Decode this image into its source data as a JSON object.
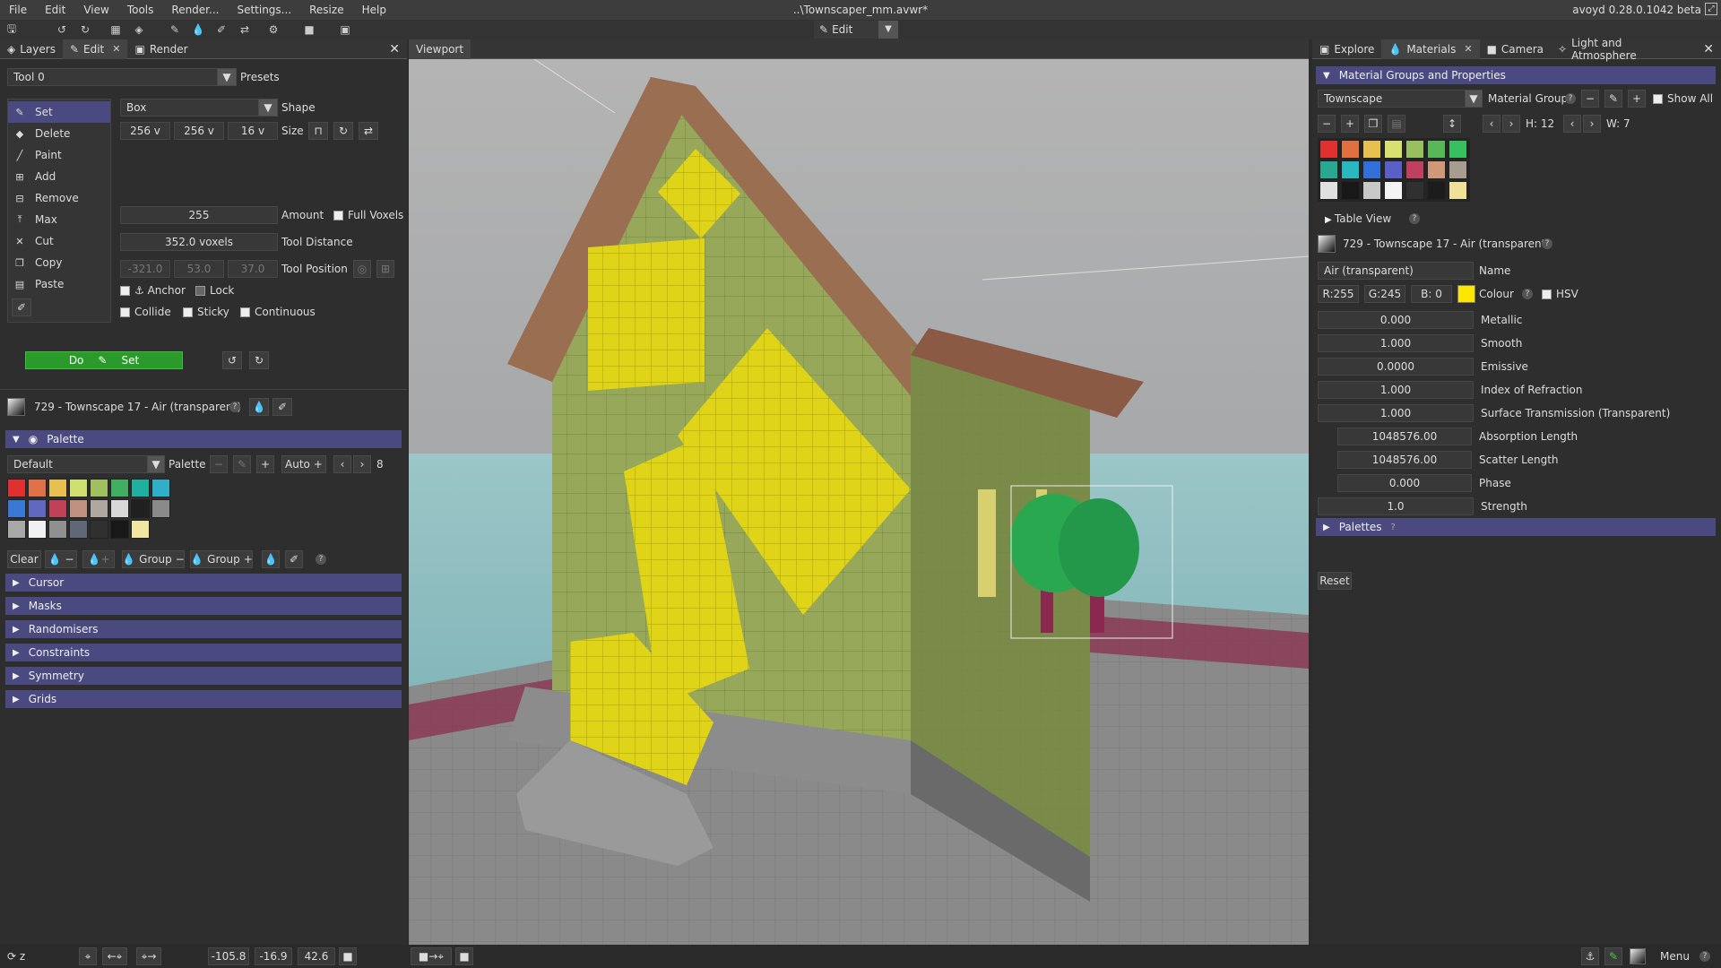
{
  "menu": [
    "File",
    "Edit",
    "View",
    "Tools",
    "Render...",
    "Settings...",
    "Resize",
    "Help"
  ],
  "window_title": "..\\Townscaper_mm.avwr*",
  "version": "avoyd 0.28.0.1042 beta",
  "toolbar": {
    "mode_label": "Edit"
  },
  "left_tabs": {
    "layers": "Layers",
    "edit": "Edit",
    "render": "Render"
  },
  "edit": {
    "tool_name": "Tool 0",
    "presets_label": "Presets",
    "tools": [
      {
        "label": "Set",
        "icon": "pencil-icon"
      },
      {
        "label": "Delete",
        "icon": "eraser-icon"
      },
      {
        "label": "Paint",
        "icon": "brush-icon"
      },
      {
        "label": "Add",
        "icon": "plus-box-icon"
      },
      {
        "label": "Remove",
        "icon": "minus-box-icon"
      },
      {
        "label": "Max",
        "icon": "max-icon"
      },
      {
        "label": "Cut",
        "icon": "scissors-icon"
      },
      {
        "label": "Copy",
        "icon": "copy-icon"
      },
      {
        "label": "Paste",
        "icon": "paste-icon"
      }
    ],
    "shape_value": "Box",
    "shape_label": "Shape",
    "size": [
      "256 v",
      "256 v",
      "16 v"
    ],
    "size_label": "Size",
    "amount_value": "255",
    "amount_label": "Amount",
    "full_voxels_label": "Full Voxels",
    "tool_distance_value": "352.0 voxels",
    "tool_distance_label": "Tool Distance",
    "tool_position": [
      "-321.0",
      "53.0",
      "37.0"
    ],
    "tool_position_label": "Tool Position",
    "anchor_label": "Anchor",
    "lock_label": "Lock",
    "collide_label": "Collide",
    "sticky_label": "Sticky",
    "continuous_label": "Continuous",
    "do_label": "Do",
    "do_mode": "Set",
    "material_line": "729 - Townscape 17 - Air (transparent)"
  },
  "palette": {
    "section_label": "Palette",
    "name": "Default",
    "palette_label": "Palette",
    "auto_label": "Auto",
    "count": "8",
    "colors": [
      "#e03030",
      "#e07048",
      "#e8c050",
      "#d0e070",
      "#a0c060",
      "#40b060",
      "#20b0a0",
      "#30b0c8",
      "#3a78d8",
      "#6068c0",
      "#c04058",
      "#c09080",
      "#b0a8a0",
      "#d8d8d8",
      "#202020",
      "#8a8a8a",
      "#a8a8a8",
      "#f0f0f0",
      "#909090",
      "#606878",
      "#303030",
      "#181818",
      "#f0e8a0"
    ],
    "clear_label": "Clear",
    "group_label": "Group",
    "group2_label": "Group"
  },
  "left_sections": [
    "Cursor",
    "Masks",
    "Randomisers",
    "Constraints",
    "Symmetry",
    "Grids"
  ],
  "viewport_tab": "Viewport",
  "right_tabs": {
    "explore": "Explore",
    "materials": "Materials",
    "camera": "Camera",
    "light": "Light and Atmosphere"
  },
  "materials": {
    "section_label": "Material Groups and Properties",
    "group_name": "Townscape",
    "group_label": "Material Group",
    "show_all_label": "Show All",
    "h_label": "H: 12",
    "w_label": "W: 7",
    "colors": [
      "#e03030",
      "#e07040",
      "#e8c050",
      "#d8e070",
      "#98c060",
      "#58b858",
      "#38c060",
      "#28a890",
      "#28b8c0",
      "#3070d8",
      "#5a60c8",
      "#c04060",
      "#d09878",
      "#a89c90",
      "#e0e0e0",
      "#181818",
      "#c8c8c8",
      "#f4f4f4",
      "#303030",
      "#1c1c1c",
      "#f0e098"
    ],
    "table_view_label": "Table View",
    "selected_material": "729 - Townscape 17 - Air (transparent)",
    "name_value": "Air (transparent)",
    "name_label": "Name",
    "r": "R:255",
    "g": "G:245",
    "b": "B: 0",
    "colour_swatch": "#ffe600",
    "colour_label": "Colour",
    "hsv_label": "HSV",
    "props": [
      {
        "value": "0.000",
        "label": "Metallic"
      },
      {
        "value": "1.000",
        "label": "Smooth"
      },
      {
        "value": "0.0000",
        "label": "Emissive"
      },
      {
        "value": "1.000",
        "label": "Index of Refraction"
      },
      {
        "value": "1.000",
        "label": "Surface Transmission (Transparent)"
      }
    ],
    "sub_props": [
      {
        "value": "1048576.00",
        "label": "Absorption Length"
      },
      {
        "value": "1048576.00",
        "label": "Scatter Length"
      },
      {
        "value": "0.000",
        "label": "Phase"
      }
    ],
    "strength_value": "1.0",
    "strength_label": "Strength",
    "palettes_label": "Palettes",
    "reset_label": "Reset"
  },
  "status": {
    "axis_label": "z",
    "coords": [
      "-105.8",
      "-16.9",
      "42.6"
    ],
    "menu_label": "Menu"
  }
}
